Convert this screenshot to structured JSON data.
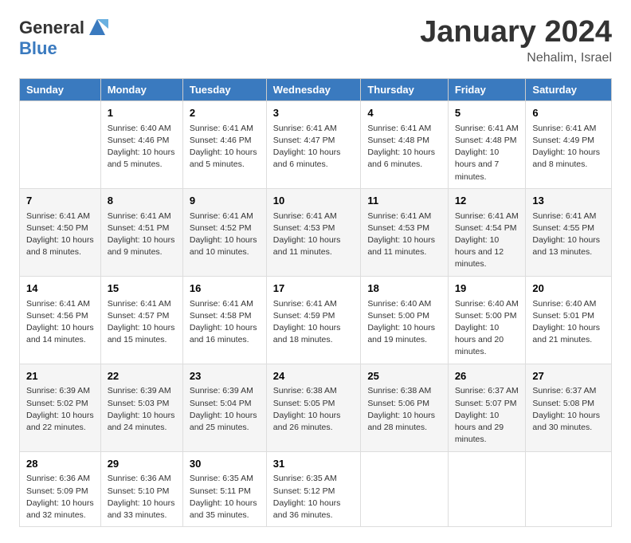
{
  "header": {
    "logo_general": "General",
    "logo_blue": "Blue",
    "month_title": "January 2024",
    "subtitle": "Nehalim, Israel"
  },
  "columns": [
    "Sunday",
    "Monday",
    "Tuesday",
    "Wednesday",
    "Thursday",
    "Friday",
    "Saturday"
  ],
  "weeks": [
    [
      {
        "day": "",
        "sunrise": "",
        "sunset": "",
        "daylight": ""
      },
      {
        "day": "1",
        "sunrise": "Sunrise: 6:40 AM",
        "sunset": "Sunset: 4:46 PM",
        "daylight": "Daylight: 10 hours and 5 minutes."
      },
      {
        "day": "2",
        "sunrise": "Sunrise: 6:41 AM",
        "sunset": "Sunset: 4:46 PM",
        "daylight": "Daylight: 10 hours and 5 minutes."
      },
      {
        "day": "3",
        "sunrise": "Sunrise: 6:41 AM",
        "sunset": "Sunset: 4:47 PM",
        "daylight": "Daylight: 10 hours and 6 minutes."
      },
      {
        "day": "4",
        "sunrise": "Sunrise: 6:41 AM",
        "sunset": "Sunset: 4:48 PM",
        "daylight": "Daylight: 10 hours and 6 minutes."
      },
      {
        "day": "5",
        "sunrise": "Sunrise: 6:41 AM",
        "sunset": "Sunset: 4:48 PM",
        "daylight": "Daylight: 10 hours and 7 minutes."
      },
      {
        "day": "6",
        "sunrise": "Sunrise: 6:41 AM",
        "sunset": "Sunset: 4:49 PM",
        "daylight": "Daylight: 10 hours and 8 minutes."
      }
    ],
    [
      {
        "day": "7",
        "sunrise": "Sunrise: 6:41 AM",
        "sunset": "Sunset: 4:50 PM",
        "daylight": "Daylight: 10 hours and 8 minutes."
      },
      {
        "day": "8",
        "sunrise": "Sunrise: 6:41 AM",
        "sunset": "Sunset: 4:51 PM",
        "daylight": "Daylight: 10 hours and 9 minutes."
      },
      {
        "day": "9",
        "sunrise": "Sunrise: 6:41 AM",
        "sunset": "Sunset: 4:52 PM",
        "daylight": "Daylight: 10 hours and 10 minutes."
      },
      {
        "day": "10",
        "sunrise": "Sunrise: 6:41 AM",
        "sunset": "Sunset: 4:53 PM",
        "daylight": "Daylight: 10 hours and 11 minutes."
      },
      {
        "day": "11",
        "sunrise": "Sunrise: 6:41 AM",
        "sunset": "Sunset: 4:53 PM",
        "daylight": "Daylight: 10 hours and 11 minutes."
      },
      {
        "day": "12",
        "sunrise": "Sunrise: 6:41 AM",
        "sunset": "Sunset: 4:54 PM",
        "daylight": "Daylight: 10 hours and 12 minutes."
      },
      {
        "day": "13",
        "sunrise": "Sunrise: 6:41 AM",
        "sunset": "Sunset: 4:55 PM",
        "daylight": "Daylight: 10 hours and 13 minutes."
      }
    ],
    [
      {
        "day": "14",
        "sunrise": "Sunrise: 6:41 AM",
        "sunset": "Sunset: 4:56 PM",
        "daylight": "Daylight: 10 hours and 14 minutes."
      },
      {
        "day": "15",
        "sunrise": "Sunrise: 6:41 AM",
        "sunset": "Sunset: 4:57 PM",
        "daylight": "Daylight: 10 hours and 15 minutes."
      },
      {
        "day": "16",
        "sunrise": "Sunrise: 6:41 AM",
        "sunset": "Sunset: 4:58 PM",
        "daylight": "Daylight: 10 hours and 16 minutes."
      },
      {
        "day": "17",
        "sunrise": "Sunrise: 6:41 AM",
        "sunset": "Sunset: 4:59 PM",
        "daylight": "Daylight: 10 hours and 18 minutes."
      },
      {
        "day": "18",
        "sunrise": "Sunrise: 6:40 AM",
        "sunset": "Sunset: 5:00 PM",
        "daylight": "Daylight: 10 hours and 19 minutes."
      },
      {
        "day": "19",
        "sunrise": "Sunrise: 6:40 AM",
        "sunset": "Sunset: 5:00 PM",
        "daylight": "Daylight: 10 hours and 20 minutes."
      },
      {
        "day": "20",
        "sunrise": "Sunrise: 6:40 AM",
        "sunset": "Sunset: 5:01 PM",
        "daylight": "Daylight: 10 hours and 21 minutes."
      }
    ],
    [
      {
        "day": "21",
        "sunrise": "Sunrise: 6:39 AM",
        "sunset": "Sunset: 5:02 PM",
        "daylight": "Daylight: 10 hours and 22 minutes."
      },
      {
        "day": "22",
        "sunrise": "Sunrise: 6:39 AM",
        "sunset": "Sunset: 5:03 PM",
        "daylight": "Daylight: 10 hours and 24 minutes."
      },
      {
        "day": "23",
        "sunrise": "Sunrise: 6:39 AM",
        "sunset": "Sunset: 5:04 PM",
        "daylight": "Daylight: 10 hours and 25 minutes."
      },
      {
        "day": "24",
        "sunrise": "Sunrise: 6:38 AM",
        "sunset": "Sunset: 5:05 PM",
        "daylight": "Daylight: 10 hours and 26 minutes."
      },
      {
        "day": "25",
        "sunrise": "Sunrise: 6:38 AM",
        "sunset": "Sunset: 5:06 PM",
        "daylight": "Daylight: 10 hours and 28 minutes."
      },
      {
        "day": "26",
        "sunrise": "Sunrise: 6:37 AM",
        "sunset": "Sunset: 5:07 PM",
        "daylight": "Daylight: 10 hours and 29 minutes."
      },
      {
        "day": "27",
        "sunrise": "Sunrise: 6:37 AM",
        "sunset": "Sunset: 5:08 PM",
        "daylight": "Daylight: 10 hours and 30 minutes."
      }
    ],
    [
      {
        "day": "28",
        "sunrise": "Sunrise: 6:36 AM",
        "sunset": "Sunset: 5:09 PM",
        "daylight": "Daylight: 10 hours and 32 minutes."
      },
      {
        "day": "29",
        "sunrise": "Sunrise: 6:36 AM",
        "sunset": "Sunset: 5:10 PM",
        "daylight": "Daylight: 10 hours and 33 minutes."
      },
      {
        "day": "30",
        "sunrise": "Sunrise: 6:35 AM",
        "sunset": "Sunset: 5:11 PM",
        "daylight": "Daylight: 10 hours and 35 minutes."
      },
      {
        "day": "31",
        "sunrise": "Sunrise: 6:35 AM",
        "sunset": "Sunset: 5:12 PM",
        "daylight": "Daylight: 10 hours and 36 minutes."
      },
      {
        "day": "",
        "sunrise": "",
        "sunset": "",
        "daylight": ""
      },
      {
        "day": "",
        "sunrise": "",
        "sunset": "",
        "daylight": ""
      },
      {
        "day": "",
        "sunrise": "",
        "sunset": "",
        "daylight": ""
      }
    ]
  ]
}
